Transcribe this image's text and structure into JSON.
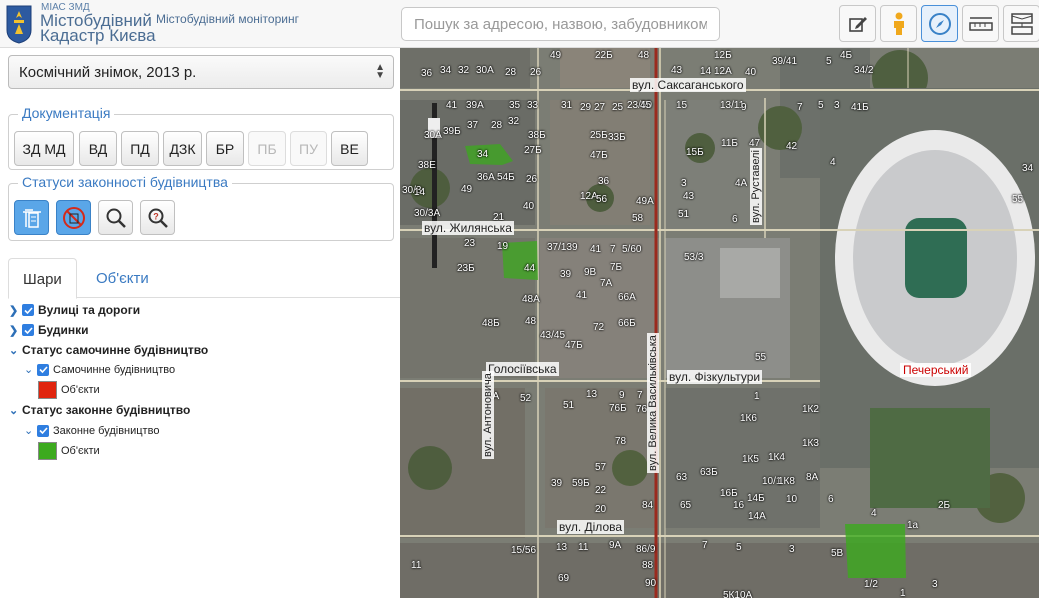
{
  "header": {
    "org_small": "МІАС ЗМД",
    "logo_line1": "Містобудівний",
    "logo_line2": "Кадастр Києва",
    "subtitle": "Містобудівний моніторинг",
    "search_placeholder": "Пошук за адресою, назвою, забудовником...",
    "tools": [
      "edit-icon",
      "street-view-icon",
      "compass-icon",
      "measure-icon",
      "layers-tool-icon"
    ]
  },
  "sidebar": {
    "layer_select": "Космічний знімок, 2013 р.",
    "documentation": {
      "legend": "Документація",
      "buttons": [
        {
          "label": "ЗД МД",
          "enabled": true
        },
        {
          "label": "ВД",
          "enabled": true
        },
        {
          "label": "ПД",
          "enabled": true
        },
        {
          "label": "ДЗК",
          "enabled": true
        },
        {
          "label": "БР",
          "enabled": true
        },
        {
          "label": "ПБ",
          "enabled": false
        },
        {
          "label": "ПУ",
          "enabled": false
        },
        {
          "label": "ВЕ",
          "enabled": true
        }
      ]
    },
    "statuses": {
      "legend": "Статуси законності будівництва",
      "buttons": [
        "legal-construction-icon",
        "illegal-construction-icon",
        "search-icon",
        "question-search-icon"
      ]
    },
    "tabs": [
      "Шари",
      "Об'єкти"
    ],
    "tree": {
      "streets": "Вулиці та дороги",
      "buildings": "Будинки",
      "illegal_status": "Статус самочинне будівництво",
      "illegal_item": "Самочинне будівництво",
      "illegal_objects": "Об'єкти",
      "illegal_color": "#e0240e",
      "legal_status": "Статус законне будівництво",
      "legal_item": "Законне будівництво",
      "legal_objects": "Об'єкти",
      "legal_color": "#3caa1e"
    }
  },
  "map": {
    "streets": {
      "saksahanskoho": "вул. Саксаганського",
      "zhylianska": "вул. Жилянська",
      "holosiivska": "Голосіївська",
      "fizkultury": "вул. Фізкультури",
      "dilova": "вул. Ділова",
      "antonovycha": "вул. Антоновича",
      "velyka_vasylkivska": "вул. Велика Васильківська",
      "rustaveli": "вул. Руставелі"
    },
    "district": "Печерський",
    "labels": [
      "36",
      "34",
      "32",
      "30А",
      "28",
      "26",
      "22Б",
      "48",
      "43",
      "14",
      "12А",
      "40",
      "12Б",
      "39/41",
      "4Б",
      "5",
      "34/2",
      "49",
      "41",
      "39А",
      "35",
      "33",
      "31",
      "29",
      "27",
      "25",
      "23/50",
      "45",
      "15",
      "13/11",
      "9",
      "7",
      "5",
      "3",
      "41Б",
      "39Б",
      "37",
      "28",
      "32",
      "38Б",
      "34",
      "27Б",
      "25Б",
      "33Б",
      "47Б",
      "15Б",
      "11Б",
      "47",
      "42",
      "4",
      "30А",
      "38Е",
      "36А",
      "54Б",
      "36",
      "26",
      "49",
      "3",
      "4А",
      "34",
      "30/3",
      "14",
      "12А",
      "56",
      "49А",
      "43",
      "55",
      "30/3А",
      "21",
      "40",
      "58",
      "51",
      "6",
      "23",
      "19",
      "37/139",
      "41",
      "7",
      "5/60",
      "53/3",
      "23Б",
      "44",
      "39",
      "9В",
      "7Б",
      "41",
      "7А",
      "66А",
      "48А",
      "48Б",
      "48",
      "72",
      "66Б",
      "43/45",
      "47Б",
      "55",
      "2А",
      "51",
      "13",
      "9",
      "7",
      "1",
      "1К2",
      "52",
      "76Б",
      "76",
      "1К6",
      "78",
      "1К3",
      "57",
      "63",
      "63Б",
      "1К5",
      "1К4",
      "8А",
      "39",
      "59Б",
      "22",
      "10/1",
      "1К8",
      "10",
      "20",
      "84",
      "65",
      "16Б",
      "14Б",
      "16",
      "14А",
      "6",
      "2Б",
      "4",
      "1а",
      "15/56",
      "13",
      "11",
      "9А",
      "86/9",
      "7",
      "5",
      "3",
      "5В",
      "11",
      "69",
      "88",
      "1/2",
      "3",
      "90",
      "5К10А",
      "1"
    ]
  }
}
